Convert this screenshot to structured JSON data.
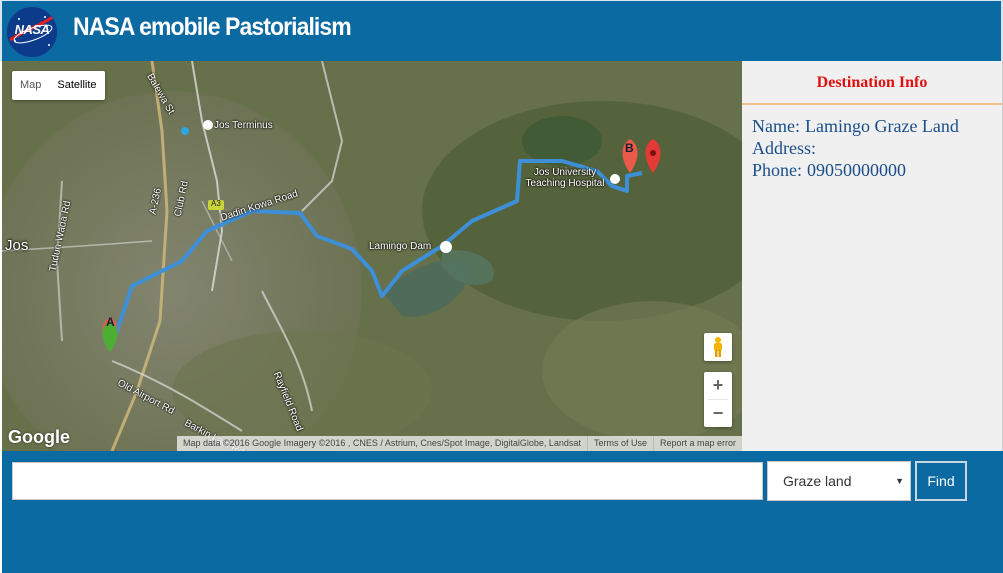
{
  "header": {
    "logo_text": "NASA",
    "title": "NASA emobile Pastorialism"
  },
  "map": {
    "type_buttons": [
      "Map",
      "Satellite"
    ],
    "labels": {
      "jos_terminus": "Jos Terminus",
      "jos_city": "Jos",
      "lamingo_dam": "Lamingo Dam",
      "hospital": "Jos University Teaching Hospital",
      "dadin_kowa_road": "Dadin Kowa Road",
      "old_airport_rd": "Old Airport Rd",
      "barkin_ladi_rd": "Barkin Ladi Rd",
      "rayfield_road": "Rayfield Road",
      "club_rd": "Club Rd",
      "tudun_wada_rd": "Tudun Wada Rd",
      "a236": "A-236",
      "a3": "A3",
      "balewa_st": "Balewa St"
    },
    "markers": {
      "start": "A",
      "end": "B"
    },
    "google_logo": "Google",
    "attribution": {
      "data": "Map data ©2016 Google Imagery ©2016 , CNES / Astrium, Cnes/Spot Image, DigitalGlobe, Landsat",
      "terms": "Terms of Use",
      "report": "Report a map error"
    },
    "zoom_in": "+",
    "zoom_out": "−"
  },
  "info": {
    "heading": "Destination Info",
    "name_label": "Name:",
    "name_value": "Lamingo Graze Land",
    "address_label": "Address:",
    "address_value": "",
    "phone_label": "Phone:",
    "phone_value": "09050000000"
  },
  "search": {
    "input_value": "",
    "placeholder": "",
    "select_value": "Graze land",
    "find_label": "Find"
  },
  "colors": {
    "brand_blue": "#0b6aa1",
    "route_blue": "#3d8fd8",
    "heading_red": "#e01010"
  }
}
